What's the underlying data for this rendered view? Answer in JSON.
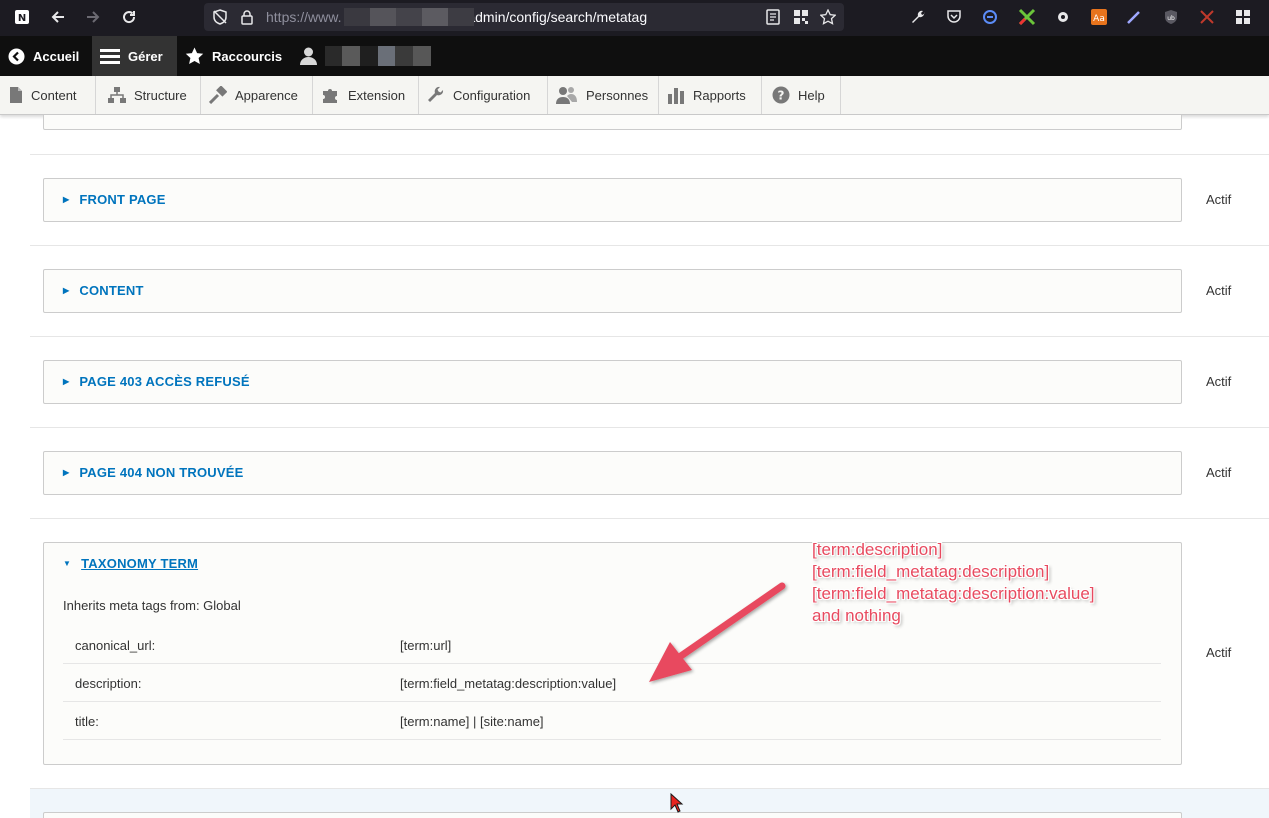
{
  "browser": {
    "url_prefix": "https://www.",
    "url_path": "/admin/config/search/metatag"
  },
  "toolbar": {
    "home": "Accueil",
    "manage": "Gérer",
    "shortcuts": "Raccourcis"
  },
  "tray": {
    "items": [
      {
        "label": "Content",
        "icon": "file-icon"
      },
      {
        "label": "Structure",
        "icon": "structure-icon"
      },
      {
        "label": "Apparence",
        "icon": "brush-icon"
      },
      {
        "label": "Extension",
        "icon": "puzzle-icon"
      },
      {
        "label": "Configuration",
        "icon": "wrench-icon"
      },
      {
        "label": "Personnes",
        "icon": "people-icon"
      },
      {
        "label": "Rapports",
        "icon": "bar-chart-icon"
      },
      {
        "label": "Help",
        "icon": "help-icon"
      }
    ]
  },
  "sections": [
    {
      "title": "FRONT PAGE",
      "status": "Actif"
    },
    {
      "title": "CONTENT",
      "status": "Actif"
    },
    {
      "title": "PAGE 403 ACCÈS REFUSÉ",
      "status": "Actif"
    },
    {
      "title": "PAGE 404 NON TROUVÉE",
      "status": "Actif"
    }
  ],
  "taxonomy": {
    "title": "TAXONOMY TERM",
    "status": "Actif",
    "inherits": "Inherits meta tags from: Global",
    "rows": [
      {
        "key": "canonical_url:",
        "value": "[term:url]"
      },
      {
        "key": "description:",
        "value": "[term:field_metatag:description:value]"
      },
      {
        "key": "title:",
        "value": "[term:name] | [site:name]"
      }
    ]
  },
  "annotation": {
    "lines": [
      "[term:description]",
      "[term:field_metatag:description]",
      "[term:field_metatag:description:value]",
      "and nothing"
    ],
    "color": "#e84a5f"
  },
  "colors": {
    "link": "#0074bd",
    "toolbar": "#0f0f0f",
    "tray": "#f5f5f2"
  }
}
